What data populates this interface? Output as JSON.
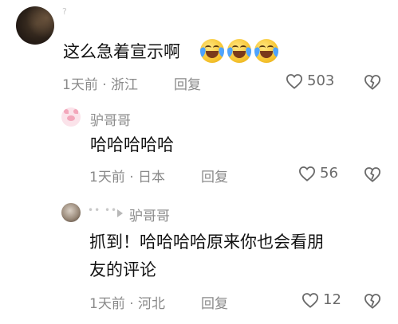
{
  "comments": [
    {
      "text": "这么急着宣示啊",
      "emojis": [
        "laugh-cry-emoji",
        "laugh-cry-emoji",
        "laugh-cry-emoji"
      ],
      "time": "1天前",
      "location": "浙江",
      "reply_label": "回复",
      "like_count": "503",
      "top_hint": "?"
    },
    {
      "username": "驴哥哥",
      "text": "哈哈哈哈哈",
      "time": "1天前",
      "location": "日本",
      "reply_label": "回复",
      "like_count": "56"
    },
    {
      "blurred_user": "•• ••",
      "reply_to": "驴哥哥",
      "text_line1": "抓到！哈哈哈哈原来你也会看朋",
      "text_line2": "友的评论",
      "time": "1天前",
      "location": "河北",
      "reply_label": "回复",
      "like_count": "12"
    }
  ],
  "separator": "·",
  "colors": {
    "meta_gray": "#8a8a8a",
    "text_black": "#111111",
    "icon_gray": "#6a6a6a"
  }
}
